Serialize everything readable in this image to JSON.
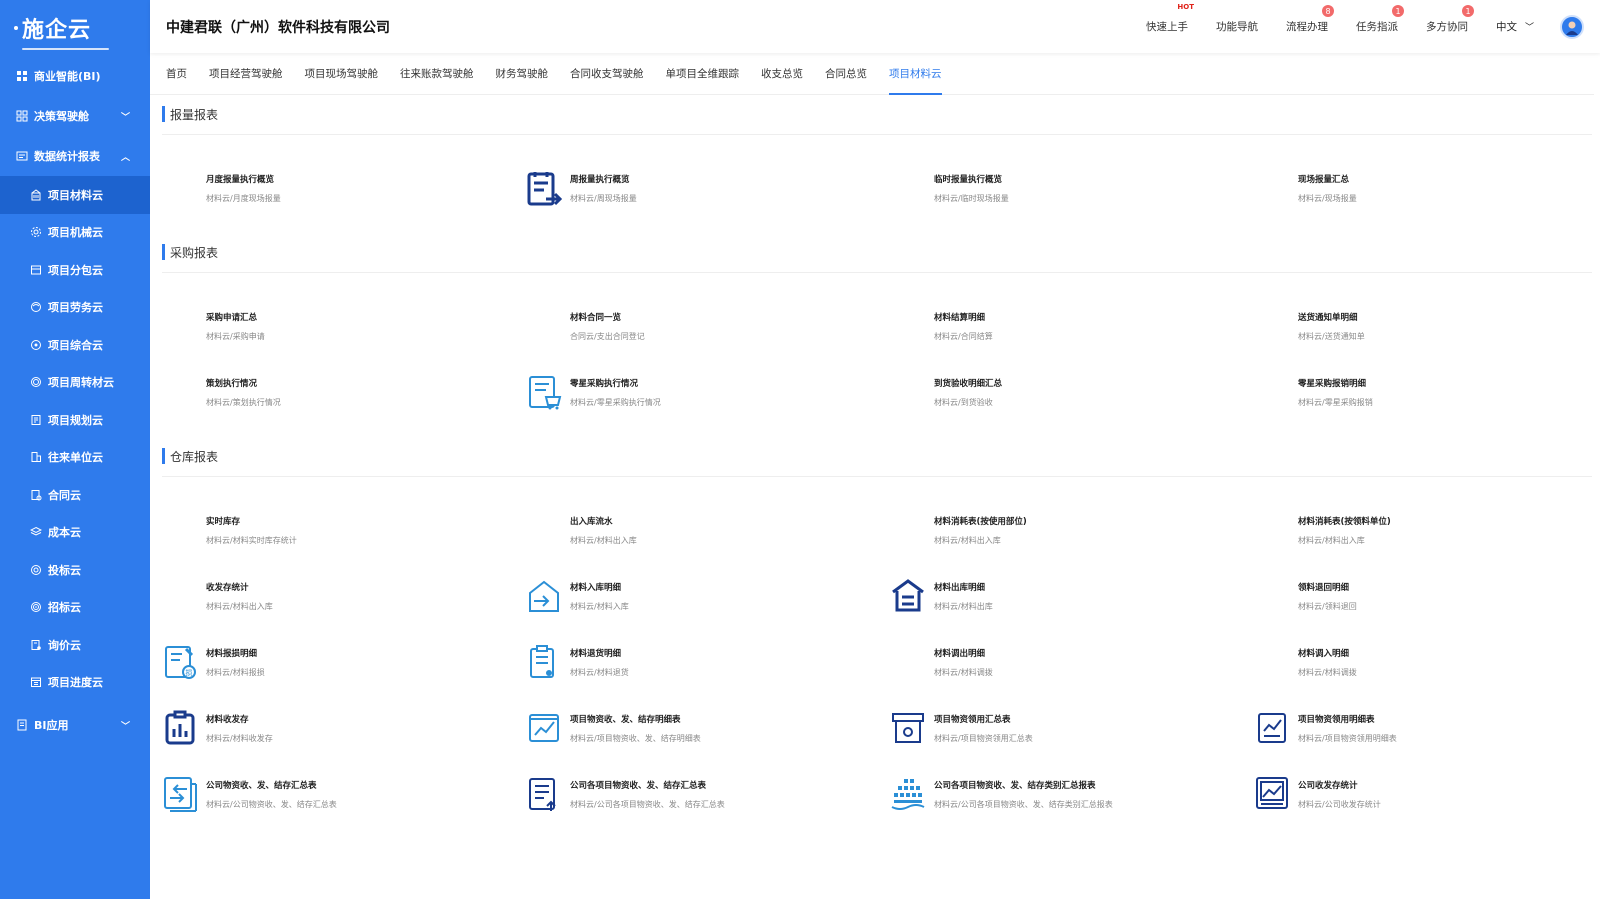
{
  "brand": {
    "logo_text": "施企云"
  },
  "sidebar": {
    "groups": [
      {
        "label": "商业智能(BI)",
        "icon": "grid-icon"
      },
      {
        "label": "决策驾驶舱",
        "icon": "dashboard-icon"
      },
      {
        "label": "数据统计报表",
        "icon": "report-icon"
      }
    ],
    "items": [
      {
        "label": "项目材料云",
        "icon": "building-icon"
      },
      {
        "label": "项目机械云",
        "icon": "gear-icon"
      },
      {
        "label": "项目分包云",
        "icon": "package-icon"
      },
      {
        "label": "项目劳务云",
        "icon": "worker-icon"
      },
      {
        "label": "项目综合云",
        "icon": "cluster-icon"
      },
      {
        "label": "项目周转材云",
        "icon": "cycle-icon"
      },
      {
        "label": "项目规划云",
        "icon": "plan-icon"
      },
      {
        "label": "往来单位云",
        "icon": "company-icon"
      },
      {
        "label": "合同云",
        "icon": "contract-icon"
      },
      {
        "label": "成本云",
        "icon": "layers-icon"
      },
      {
        "label": "投标云",
        "icon": "bid-icon"
      },
      {
        "label": "招标云",
        "icon": "target-icon"
      },
      {
        "label": "询价云",
        "icon": "inquiry-icon"
      },
      {
        "label": "项目进度云",
        "icon": "calendar-icon"
      }
    ],
    "bottom_group": {
      "label": "BI应用",
      "icon": "app-icon"
    }
  },
  "header": {
    "company": "中建君联（广州）软件科技有限公司",
    "links": [
      {
        "label": "快速上手",
        "tag": "HOT"
      },
      {
        "label": "功能导航"
      },
      {
        "label": "流程办理",
        "badge": "8"
      },
      {
        "label": "任务指派",
        "badge": "1"
      },
      {
        "label": "多方协同",
        "badge": "1"
      }
    ],
    "language": "中文"
  },
  "tabs": [
    "首页",
    "项目经营驾驶舱",
    "项目现场驾驶舱",
    "往来账款驾驶舱",
    "财务驾驶舱",
    "合同收支驾驶舱",
    "单项目全维跟踪",
    "收支总览",
    "合同总览",
    "项目材料云"
  ],
  "active_tab": "项目材料云",
  "sections": [
    {
      "title": "报量报表",
      "cards": [
        {
          "title": "月度报量执行概览",
          "sub": "材料云/月度现场报量",
          "icon": ""
        },
        {
          "title": "周报量执行概览",
          "sub": "材料云/周现场报量",
          "icon": "list-arrow-icon"
        },
        {
          "title": "临时报量执行概览",
          "sub": "材料云/临时现场报量",
          "icon": ""
        },
        {
          "title": "现场报量汇总",
          "sub": "材料云/现场报量",
          "icon": ""
        }
      ]
    },
    {
      "title": "采购报表",
      "cards": [
        {
          "title": "采购申请汇总",
          "sub": "材料云/采购申请",
          "icon": ""
        },
        {
          "title": "材料合同一览",
          "sub": "合同云/支出合同登记",
          "icon": ""
        },
        {
          "title": "材料结算明细",
          "sub": "材料云/合同结算",
          "icon": ""
        },
        {
          "title": "送货通知单明细",
          "sub": "材料云/送货通知单",
          "icon": ""
        },
        {
          "title": "策划执行情况",
          "sub": "材料云/策划执行情况",
          "icon": ""
        },
        {
          "title": "零星采购执行情况",
          "sub": "材料云/零星采购执行情况",
          "icon": "cart-list-icon"
        },
        {
          "title": "到货验收明细汇总",
          "sub": "材料云/到货验收",
          "icon": ""
        },
        {
          "title": "零星采购报销明细",
          "sub": "材料云/零星采购报销",
          "icon": ""
        }
      ]
    },
    {
      "title": "仓库报表",
      "cards": [
        {
          "title": "实时库存",
          "sub": "材料云/材料实时库存统计",
          "icon": ""
        },
        {
          "title": "出入库流水",
          "sub": "材料云/材料出入库",
          "icon": ""
        },
        {
          "title": "材料消耗表(按使用部位)",
          "sub": "材料云/材料出入库",
          "icon": ""
        },
        {
          "title": "材料消耗表(按领料单位)",
          "sub": "材料云/材料出入库",
          "icon": ""
        },
        {
          "title": "收发存统计",
          "sub": "材料云/材料出入库",
          "icon": ""
        },
        {
          "title": "材料入库明细",
          "sub": "材料云/材料入库",
          "icon": "warehouse-in-icon"
        },
        {
          "title": "材料出库明细",
          "sub": "材料云/材料出库",
          "icon": "warehouse-out-icon"
        },
        {
          "title": "领料退回明细",
          "sub": "材料云/领料退回",
          "icon": ""
        },
        {
          "title": "材料报损明细",
          "sub": "材料云/材料报损",
          "icon": "damage-report-icon"
        },
        {
          "title": "材料退货明细",
          "sub": "材料云/材料退货",
          "icon": "return-clipboard-icon"
        },
        {
          "title": "材料调出明细",
          "sub": "材料云/材料调拨",
          "icon": ""
        },
        {
          "title": "材料调入明细",
          "sub": "材料云/材料调拨",
          "icon": ""
        },
        {
          "title": "材料收发存",
          "sub": "材料云/材料收发存",
          "icon": "bar-clipboard-icon"
        },
        {
          "title": "项目物资收、发、结存明细表",
          "sub": "材料云/项目物资收、发、结存明细表",
          "icon": "trend-doc-icon"
        },
        {
          "title": "项目物资领用汇总表",
          "sub": "材料云/项目物资领用汇总表",
          "icon": "archive-box-icon"
        },
        {
          "title": "项目物资领用明细表",
          "sub": "材料云/项目物资领用明细表",
          "icon": "chart-doc-icon"
        },
        {
          "title": "公司物资收、发、结存汇总表",
          "sub": "材料云/公司物资收、发、结存汇总表",
          "icon": "transfer-doc-icon"
        },
        {
          "title": "公司各项目物资收、发、结存汇总表",
          "sub": "材料云/公司各项目物资收、发、结存汇总表",
          "icon": "multi-doc-icon"
        },
        {
          "title": "公司各项目物资收、发、结存类别汇总报表",
          "sub": "材料云/公司各项目物资收、发、结存类别汇总报表",
          "icon": "stack-icon"
        },
        {
          "title": "公司收发存统计",
          "sub": "材料云/公司收发存统计",
          "icon": "picture-chart-icon"
        }
      ]
    }
  ],
  "colors": {
    "primary": "#2f7bec",
    "sidebar_active": "#1d63cf",
    "icon_blue": "#2b8fd6",
    "icon_dark": "#1a3b8c"
  }
}
